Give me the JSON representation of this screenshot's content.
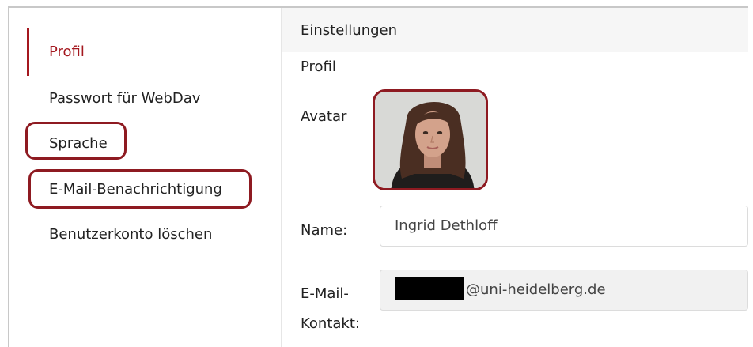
{
  "sidebar": {
    "items": [
      {
        "label": "Profil",
        "active": true
      },
      {
        "label": "Passwort für WebDav",
        "active": false
      },
      {
        "label": "Sprache",
        "active": false
      },
      {
        "label": "E-Mail-Benachrichtigung",
        "active": false
      },
      {
        "label": "Benutzerkonto löschen",
        "active": false
      }
    ]
  },
  "main": {
    "title": "Einstellungen",
    "section": "Profil",
    "avatar_label": "Avatar",
    "name_label": "Name:",
    "name_value": "Ingrid Dethloff",
    "email_label_line1": "E-Mail-",
    "email_label_line2": "Kontakt:",
    "email_value": "@uni-heidelberg.de"
  },
  "colors": {
    "accent": "#a4181f",
    "highlight": "#8e1a21"
  }
}
